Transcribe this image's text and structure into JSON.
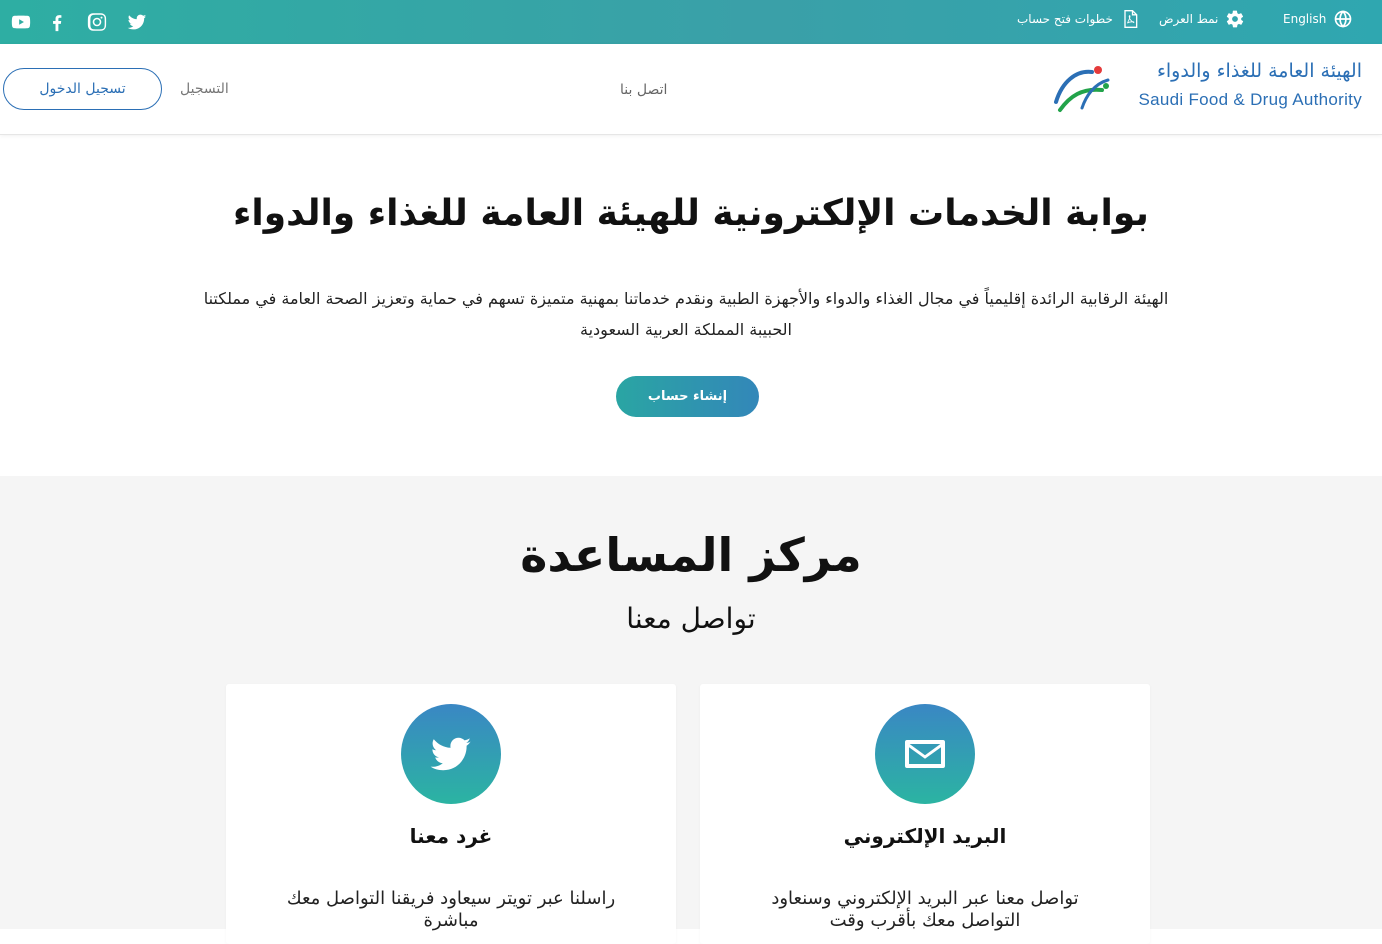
{
  "topbar": {
    "language": "English",
    "display_mode": "نمط العرض",
    "account_steps": "خطوات فتح حساب",
    "social": [
      "youtube-icon",
      "facebook-icon",
      "instagram-icon",
      "twitter-icon"
    ]
  },
  "header": {
    "logo_ar": "الهيئة العامة للغذاء والدواء",
    "logo_en": "Saudi Food & Drug Authority",
    "contact": "اتصل بنا",
    "register": "التسجيل",
    "login": "تسجيل الدخول"
  },
  "hero": {
    "title": "بوابة الخدمات الإلكترونية للهيئة العامة للغذاء والدواء",
    "description": "الهيئة الرقابية الرائدة إقليمياً في مجال الغذاء والدواء والأجهزة الطبية ونقدم خدماتنا بمهنية متميزة تسهم في حماية وتعزيز الصحة العامة في مملكتنا الحبيبة المملكة العربية السعودية",
    "cta": "إنشاء حساب"
  },
  "help": {
    "title": "مركز المساعدة",
    "subtitle": "تواصل معنا",
    "cards": [
      {
        "title": "البريد الإلكتروني",
        "text": "تواصل معنا عبر البريد الإلكتروني وسنعاود التواصل معك بأقرب وقت",
        "icon": "envelope-icon"
      },
      {
        "title": "غرد معنا",
        "text": "راسلنا عبر تويتر سيعاود فريقنا التواصل معك مباشرة",
        "icon": "twitter-bird-icon"
      }
    ]
  },
  "colors": {
    "accent": "#2b6fb5",
    "teal": "#2eaea3",
    "help_bg": "#f5f5f5"
  }
}
